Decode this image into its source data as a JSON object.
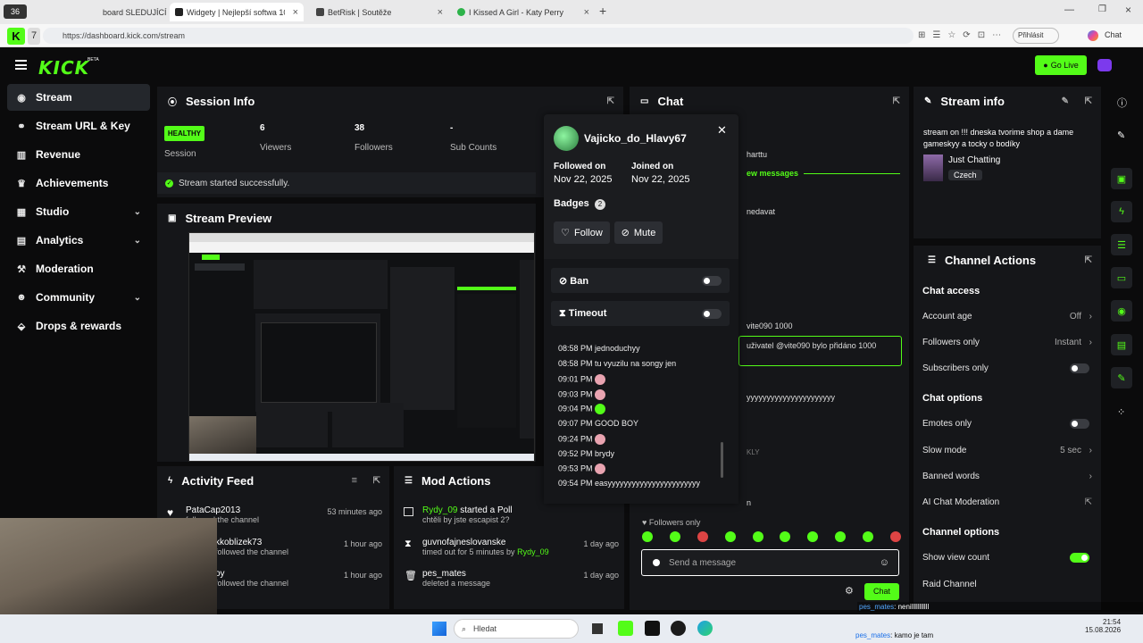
{
  "browser": {
    "tab_counter": "36",
    "tabs": [
      {
        "label": "board SLEDUJÍCÍ"
      },
      {
        "label": "Widgety | Nejlepší softwa 100 vyj"
      },
      {
        "label": "BetRisk | Soutěže"
      },
      {
        "label": "I Kissed A Girl - Katy Perry"
      }
    ],
    "url": "https://dashboard.kick.com/stream",
    "profile_label": "Přihlásit",
    "copilot_label": "Chat"
  },
  "header": {
    "logo": "KICK",
    "logo_badge": "BETA",
    "go_live_label": "Go Live"
  },
  "sidebar": {
    "items": [
      {
        "label": "Stream"
      },
      {
        "label": "Stream URL & Key"
      },
      {
        "label": "Revenue"
      },
      {
        "label": "Achievements"
      },
      {
        "label": "Studio"
      },
      {
        "label": "Analytics"
      },
      {
        "label": "Moderation"
      },
      {
        "label": "Community"
      },
      {
        "label": "Drops & rewards"
      }
    ]
  },
  "session": {
    "title": "Session Info",
    "status_badge": "HEALTHY",
    "stats": [
      {
        "value": "",
        "label": "Session"
      },
      {
        "value": "6",
        "label": "Viewers"
      },
      {
        "value": "38",
        "label": "Followers"
      },
      {
        "value": "-",
        "label": "Sub Counts"
      }
    ],
    "status_message": "Stream started successfully."
  },
  "preview": {
    "title": "Stream Preview"
  },
  "activity": {
    "title": "Activity Feed",
    "items": [
      {
        "user": "PataCap2013",
        "action": "followed the channel",
        "time": "53 minutes ago"
      },
      {
        "user": "kkoblizek73",
        "action": "followed the channel",
        "time": "1 hour ago"
      },
      {
        "user": "oy",
        "action": "followed the channel",
        "time": "1 hour ago"
      }
    ]
  },
  "mod_actions": {
    "title": "Mod Actions",
    "items": [
      {
        "user": "Rydy_09",
        "action": "started a Poll",
        "detail": "chtěli by jste escapist 2?",
        "time": ""
      },
      {
        "user": "guvnofajneslovanske",
        "action": "",
        "detail": "timed out for 5 minutes by",
        "detail_user": "Rydy_09",
        "time": "1 day ago"
      },
      {
        "user": "pes_mates",
        "action": "",
        "detail": "deleted a message",
        "time": "1 day ago"
      }
    ]
  },
  "chat": {
    "title": "Chat",
    "fragments": [
      "harttu",
      "ew messages",
      "nedavat",
      "vite090 1000",
      "uživatel @vite090 bylo přidáno 1000",
      "yyyyyyyyyyyyyyyyyyyyyy",
      "KLY",
      "n"
    ],
    "followers_only_label": "Followers only",
    "input_placeholder": "Send a message",
    "send_label": "Chat"
  },
  "user_popup": {
    "username": "Vajicko_do_Hlavy67",
    "followed_label": "Followed on",
    "followed_date": "Nov 22, 2025",
    "joined_label": "Joined on",
    "joined_date": "Nov 22, 2025",
    "badges_label": "Badges",
    "badges_count": "2",
    "follow_label": "Follow",
    "mute_label": "Mute",
    "ban_label": "Ban",
    "timeout_label": "Timeout",
    "messages": [
      {
        "time": "08:58 PM",
        "text": "jednoduchyy"
      },
      {
        "time": "08:58 PM",
        "text": "tu vyuzilu na songy jen"
      },
      {
        "time": "09:01 PM",
        "text": ""
      },
      {
        "time": "09:03 PM",
        "text": ""
      },
      {
        "time": "09:04 PM",
        "text": ""
      },
      {
        "time": "09:07 PM",
        "text": "GOOD BOY"
      },
      {
        "time": "09:24 PM",
        "text": ""
      },
      {
        "time": "09:52 PM",
        "text": "brydy"
      },
      {
        "time": "09:53 PM",
        "text": ""
      },
      {
        "time": "09:54 PM",
        "text": "easyyyyyyyyyyyyyyyyyyyyyyy"
      }
    ]
  },
  "stream_info": {
    "title": "Stream info",
    "stream_title": "stream on !!! dneska tvorime shop a dame gameskyy a tocky o bodíky",
    "category": "Just Chatting",
    "language": "Czech"
  },
  "channel_actions": {
    "title": "Channel Actions",
    "chat_access_title": "Chat access",
    "chat_access": [
      {
        "label": "Account age",
        "value": "Off"
      },
      {
        "label": "Followers only",
        "value": "Instant"
      },
      {
        "label": "Subscribers only",
        "value": ""
      }
    ],
    "chat_options_title": "Chat options",
    "chat_options": [
      {
        "label": "Emotes only",
        "value": ""
      },
      {
        "label": "Slow mode",
        "value": "5 sec"
      },
      {
        "label": "Banned words",
        "value": ""
      },
      {
        "label": "AI Chat Moderation",
        "value": ""
      }
    ],
    "channel_options_title": "Channel options",
    "channel_options": [
      {
        "label": "Show view count",
        "value": ""
      },
      {
        "label": "Raid Channel",
        "value": ""
      }
    ]
  },
  "overlay": {
    "chat_lines": [
      {
        "user": "pes_mates",
        "text": ": nenilllllllllll"
      },
      {
        "user": "vite090",
        "text": ""
      },
      {
        "user": "pes_mates",
        "text": ": kamo je tam"
      }
    ]
  },
  "taskbar": {
    "search_placeholder": "Hledat",
    "time": "21:54",
    "date": "15.08.2026"
  },
  "colors": {
    "accent": "#53fc18",
    "panel": "#151619",
    "background": "#0b0b0c"
  }
}
